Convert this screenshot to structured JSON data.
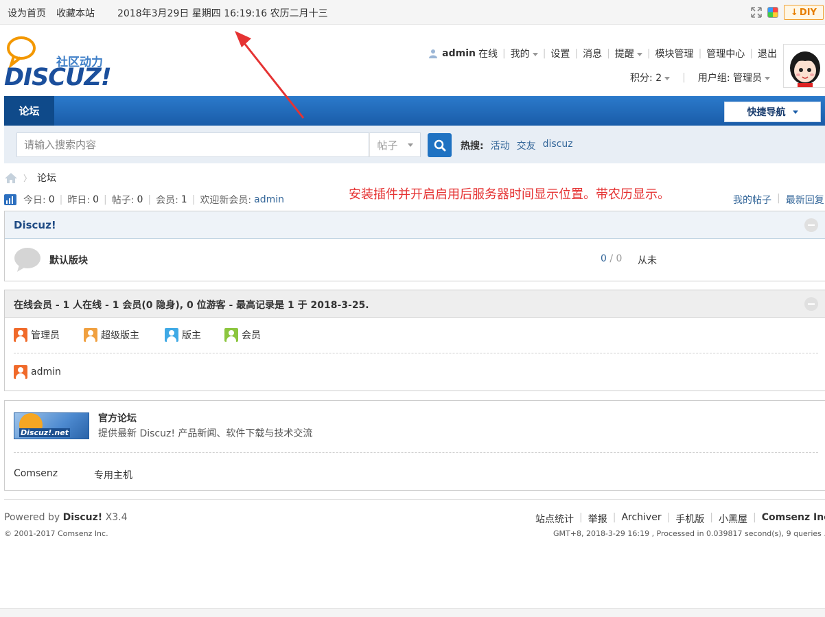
{
  "topbar": {
    "set_home": "设为首页",
    "bookmark": "收藏本站",
    "clock": "2018年3月29日 星期四 16:19:16 农历二月十三",
    "diy_label": "DIY"
  },
  "header": {
    "logo_tagline": "社区动力",
    "logo_text": "DISCUZ!",
    "username": "admin",
    "online": "在线",
    "menu": [
      "我的",
      "设置",
      "消息",
      "提醒",
      "模块管理",
      "管理中心",
      "退出"
    ],
    "credits": "积分: 2",
    "usergroup": "用户组: 管理员"
  },
  "nav": {
    "tab_forum": "论坛",
    "quick_nav": "快捷导航"
  },
  "search": {
    "placeholder": "请输入搜索内容",
    "type": "帖子",
    "hot_label": "热搜:",
    "hot_items": [
      "活动",
      "交友",
      "discuz"
    ]
  },
  "breadcrumb": {
    "current": "论坛"
  },
  "stats": {
    "today_label": "今日:",
    "today": "0",
    "yesterday_label": "昨日:",
    "yesterday": "0",
    "posts_label": "帖子:",
    "posts": "0",
    "members_label": "会员:",
    "members": "1",
    "welcome_label": "欢迎新会员:",
    "newest": "admin",
    "my_posts": "我的帖子",
    "latest_replies": "最新回复"
  },
  "annotation": "安装插件并开启启用后服务器时间显示位置。带农历显示。",
  "forum_group": {
    "title": "Discuz!",
    "forum_name": "默认版块",
    "threads": "0",
    "posts": "0",
    "last_post": "从未"
  },
  "online": {
    "title": "在线会员 - 1 人在线 - 1 会员(0 隐身), 0 位游客 - 最高记录是 1 于 2018-3-25.",
    "legend": [
      "管理员",
      "超级版主",
      "版主",
      "会员"
    ],
    "users": [
      "admin"
    ]
  },
  "links": {
    "logo_text": "Discuz!.net",
    "official_name": "官方论坛",
    "official_desc": "提供最新 Discuz! 产品新闻、软件下载与技术交流",
    "text_links": [
      "Comsenz",
      "专用主机"
    ]
  },
  "footer": {
    "powered_prefix": "Powered by",
    "powered_brand": "Discuz!",
    "version": "X3.4",
    "copyright": "© 2001-2017 Comsenz Inc.",
    "links": [
      "站点统计",
      "举报",
      "Archiver",
      "手机版",
      "小黑屋"
    ],
    "company": "Comsenz Inc.",
    "gmt": "GMT+8, 2018-3-29 16:19 , Processed in 0.039817 second(s), 9 queries ."
  },
  "colors": {
    "nav_blue": "#1a5ca8",
    "link": "#336699",
    "annotation_red": "#e53333",
    "admin_orange": "#f06a2a",
    "supermod_orange": "#f0a040",
    "mod_blue": "#3fa9e5",
    "member_green": "#8cc63f"
  }
}
